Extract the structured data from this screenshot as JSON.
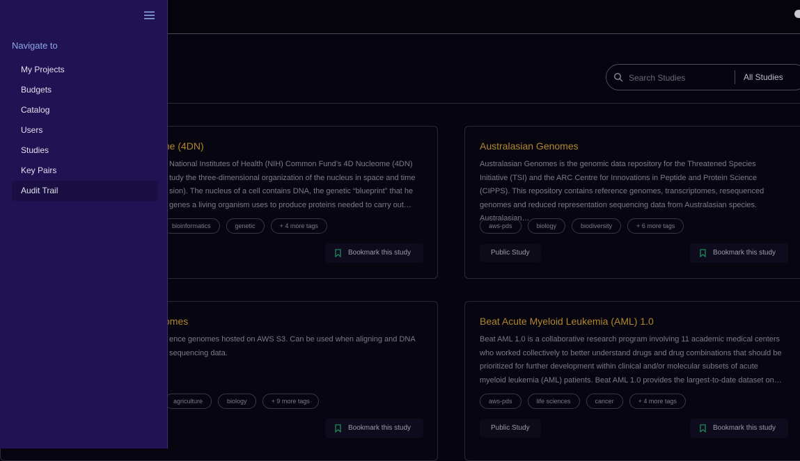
{
  "sidebar": {
    "heading": "Navigate to",
    "items": [
      {
        "label": "My Projects"
      },
      {
        "label": "Budgets"
      },
      {
        "label": "Catalog"
      },
      {
        "label": "Users"
      },
      {
        "label": "Studies"
      },
      {
        "label": "Key Pairs"
      },
      {
        "label": "Audit Trail",
        "active": true
      }
    ]
  },
  "search": {
    "placeholder": "Search Studies",
    "filter_value": "All Studies"
  },
  "cards": [
    {
      "title": "me (4DN)",
      "description": "National Institutes of Health (NIH) Common Fund’s 4D Nucleome (4DN) tudy the three-dimensional organization of the nucleus in space and time sion). The nucleus of a cell contains DNA, the genetic “blueprint” that he genes a living organism uses to produce proteins needed to carry out…",
      "tags": [
        "bioinformatics",
        "genetic",
        "+ 4 more tags"
      ],
      "bookmark_label": "Bookmark this study"
    },
    {
      "title": "Australasian Genomes",
      "description": "Australasian Genomes is the genomic data repository for the Threatened Species Initiative (TSI) and the ARC Centre for Innovations in Peptide and Protein Science (CIPPS). This repository contains reference genomes, transcriptomes, resequenced genomes and reduced representation sequencing data from Australasian species. Australasian…",
      "tags": [
        "aws-pds",
        "biology",
        "biodiversity",
        "+ 6 more tags"
      ],
      "badge": "Public Study",
      "bookmark_label": "Bookmark this study"
    },
    {
      "title": "omes",
      "description": "ence genomes hosted on AWS S3. Can be used when aligning and DNA sequencing data.",
      "tags": [
        "agriculture",
        "biology",
        "+ 9 more tags"
      ],
      "bookmark_label": "Bookmark this study"
    },
    {
      "title": "Beat Acute Myeloid Leukemia (AML) 1.0",
      "description": "Beat AML 1.0 is a collaborative research program involving 11 academic medical centers who worked collectively to better understand drugs and drug combinations that should be prioritized for further development within clinical and/or molecular subsets of acute myeloid leukemia (AML) patients. Beat AML 1.0 provides the largest-to-date dataset on…",
      "tags": [
        "aws-pds",
        "life sciences",
        "cancer",
        "+ 4 more tags"
      ],
      "badge": "Public Study",
      "bookmark_label": "Bookmark this study"
    }
  ],
  "colors": {
    "sidebar_bg": "#211254",
    "page_bg": "#06040f",
    "title_gold": "#b0872e",
    "bookmark_green": "#1f8a5a",
    "nav_heading": "#8ea8e4"
  },
  "icons": [
    "hamburger-menu-icon",
    "search-icon",
    "bookmark-icon",
    "user-avatar-icon"
  ]
}
